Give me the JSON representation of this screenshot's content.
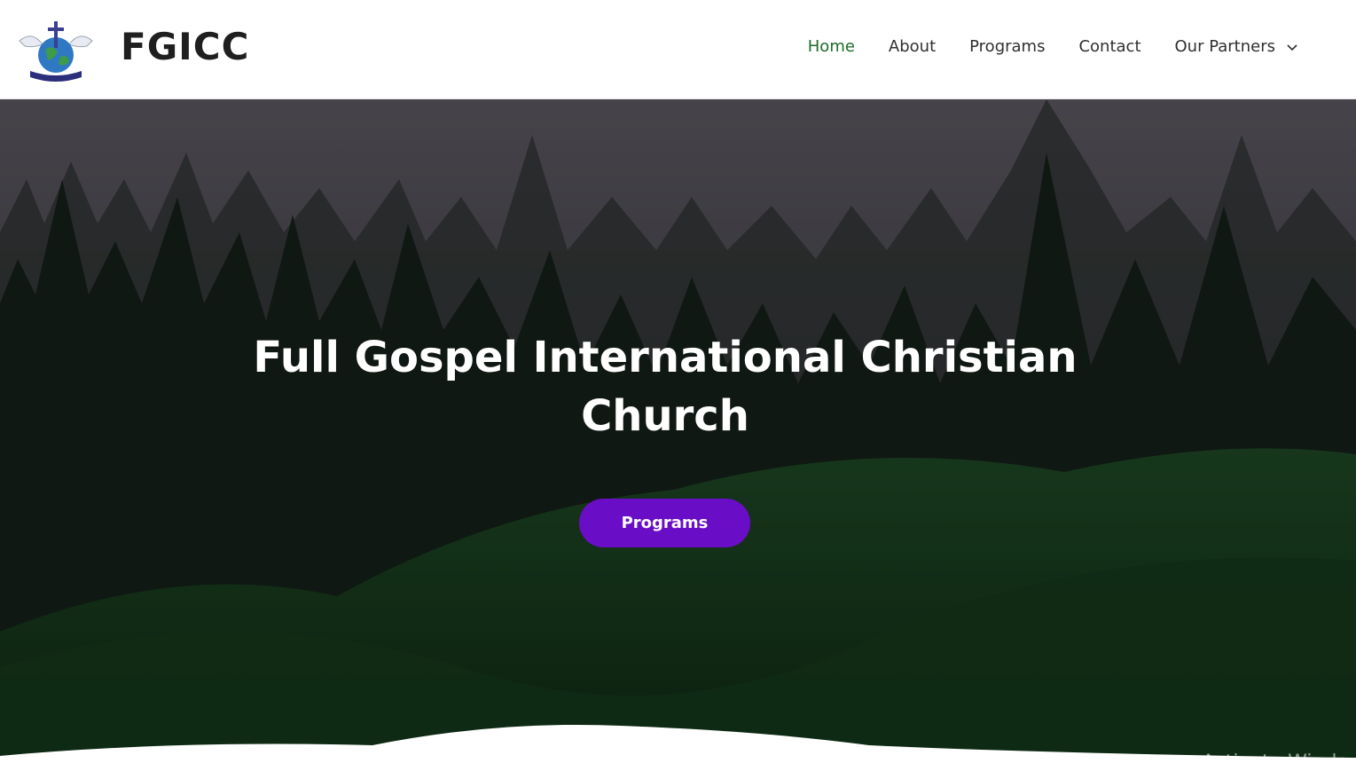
{
  "header": {
    "site_title": "FGICC",
    "logo_icon": "church-globe-doves-logo"
  },
  "nav": {
    "items": [
      {
        "label": "Home",
        "active": true
      },
      {
        "label": "About",
        "active": false
      },
      {
        "label": "Programs",
        "active": false
      },
      {
        "label": "Contact",
        "active": false
      },
      {
        "label": "Our Partners",
        "active": false,
        "has_dropdown": true
      }
    ]
  },
  "hero": {
    "title": "Full Gospel International Christian Church",
    "cta_label": "Programs"
  },
  "watermark": "Activate Windo",
  "colors": {
    "accent": "#6a0dc6",
    "nav_active": "#1e6b2a",
    "text_dark": "#2f2f2f"
  }
}
